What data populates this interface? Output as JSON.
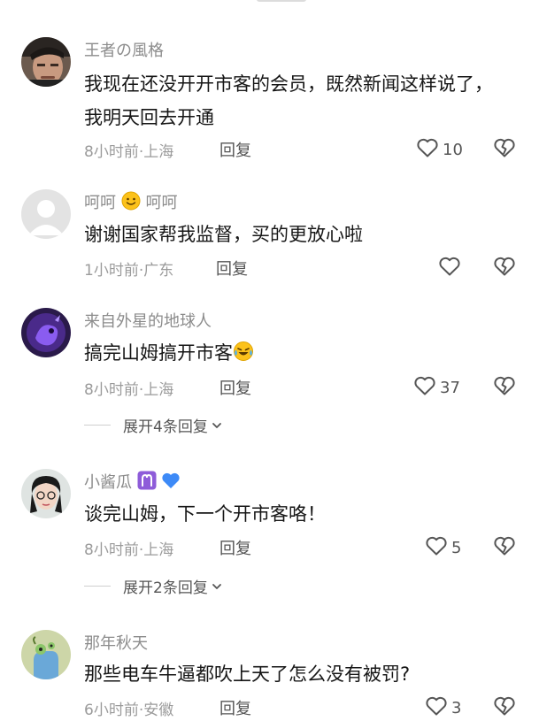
{
  "comments": [
    {
      "username": "王者の風格",
      "text": "我现在还没开开市客的会员，既然新闻这样说了，我明天回去开通",
      "time_location": "8小时前·上海",
      "reply_label": "回复",
      "likes": "10"
    },
    {
      "username_a": "呵呵",
      "username_b": "呵呵",
      "text": "谢谢国家帮我监督，买的更放心啦",
      "time_location": "1小时前·广东",
      "reply_label": "回复",
      "likes": ""
    },
    {
      "username": "来自外星的地球人",
      "text": "搞完山姆搞开市客",
      "time_location": "8小时前·上海",
      "reply_label": "回复",
      "likes": "37",
      "expand_label": "展开4条回复"
    },
    {
      "username": "小酱瓜",
      "text": "谈完山姆，下一个开市客咯！",
      "time_location": "8小时前·上海",
      "reply_label": "回复",
      "likes": "5",
      "expand_label": "展开2条回复"
    },
    {
      "username": "那年秋天",
      "text": "那些电车牛逼都吹上天了怎么没有被罚?",
      "time_location": "6小时前·安徽",
      "reply_label": "回复",
      "likes": "3"
    }
  ],
  "icons": {
    "like": "heart-outline-icon",
    "dislike": "broken-heart-icon",
    "expand": "chevron-down-icon"
  },
  "colors": {
    "secondary_text": "#8c8c8c",
    "primary_text": "#161616",
    "icon": "#555555"
  }
}
